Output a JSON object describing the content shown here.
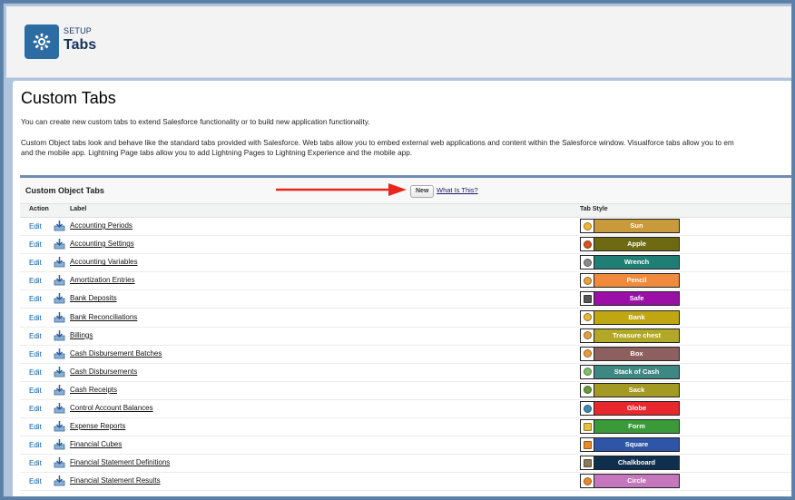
{
  "header": {
    "setup_label": "SETUP",
    "title": "Tabs"
  },
  "page": {
    "title": "Custom Tabs",
    "intro": "You can create new custom tabs to extend Salesforce functionality or to build new application functionality.",
    "desc_line1": "Custom Object tabs look and behave like the standard tabs provided with Salesforce. Web tabs allow you to embed external web applications and content within the Salesforce window. Visualforce tabs allow you to em",
    "desc_line2": "and the mobile app. Lightning Page tabs allow you to add Lightning Pages to Lightning Experience and the mobile app."
  },
  "section": {
    "title": "Custom Object Tabs",
    "new_label": "New",
    "what_is_this": "What Is This?",
    "columns": {
      "action": "Action",
      "label": "Label",
      "tab_style": "Tab Style"
    },
    "rows": [
      {
        "action": "Edit",
        "label": "Accounting Periods",
        "style": "Sun",
        "color": "#c99a3b",
        "icon": "sun-icon",
        "icon_color": "#f2b633"
      },
      {
        "action": "Edit",
        "label": "Accounting Settings",
        "style": "Apple",
        "color": "#6e6a12",
        "icon": "apple-icon",
        "icon_color": "#d9541f"
      },
      {
        "action": "Edit",
        "label": "Accounting Variables",
        "style": "Wrench",
        "color": "#1f7f74",
        "icon": "wrench-icon",
        "icon_color": "#8a8a8a"
      },
      {
        "action": "Edit",
        "label": "Amortization Entries",
        "style": "Pencil",
        "color": "#f08a3c",
        "icon": "pencil-icon",
        "icon_color": "#e8a23c"
      },
      {
        "action": "Edit",
        "label": "Bank Deposits",
        "style": "Safe",
        "color": "#9a0fa6",
        "icon": "safe-icon",
        "icon_color": "#555555"
      },
      {
        "action": "Edit",
        "label": "Bank Reconciliations",
        "style": "Bank",
        "color": "#c0a712",
        "icon": "bank-icon",
        "icon_color": "#e8b63c"
      },
      {
        "action": "Edit",
        "label": "Billings",
        "style": "Treasure chest",
        "color": "#b2a828",
        "icon": "treasure-chest-icon",
        "icon_color": "#e0a040"
      },
      {
        "action": "Edit",
        "label": "Cash Disbursement Batches",
        "style": "Box",
        "color": "#8e5f5f",
        "icon": "box-icon",
        "icon_color": "#e89a3c"
      },
      {
        "action": "Edit",
        "label": "Cash Disbursements",
        "style": "Stack of Cash",
        "color": "#3f8782",
        "icon": "cash-icon",
        "icon_color": "#7fbf6a"
      },
      {
        "action": "Edit",
        "label": "Cash Receipts",
        "style": "Sack",
        "color": "#a29a22",
        "icon": "sack-icon",
        "icon_color": "#6a9a3a"
      },
      {
        "action": "Edit",
        "label": "Control Account Balances",
        "style": "Globe",
        "color": "#e8282c",
        "icon": "globe-icon",
        "icon_color": "#3a8ab0"
      },
      {
        "action": "Edit",
        "label": "Expense Reports",
        "style": "Form",
        "color": "#3a9a3a",
        "icon": "form-icon",
        "icon_color": "#e8c03c"
      },
      {
        "action": "Edit",
        "label": "Financial Cubes",
        "style": "Square",
        "color": "#2f55a8",
        "icon": "square-icon",
        "icon_color": "#e8892c"
      },
      {
        "action": "Edit",
        "label": "Financial Statement Definitions",
        "style": "Chalkboard",
        "color": "#0f2f4f",
        "icon": "chalkboard-icon",
        "icon_color": "#8a7a5a"
      },
      {
        "action": "Edit",
        "label": "Financial Statement Results",
        "style": "Circle",
        "color": "#c577bd",
        "icon": "circle-icon",
        "icon_color": "#e8892c"
      }
    ]
  }
}
